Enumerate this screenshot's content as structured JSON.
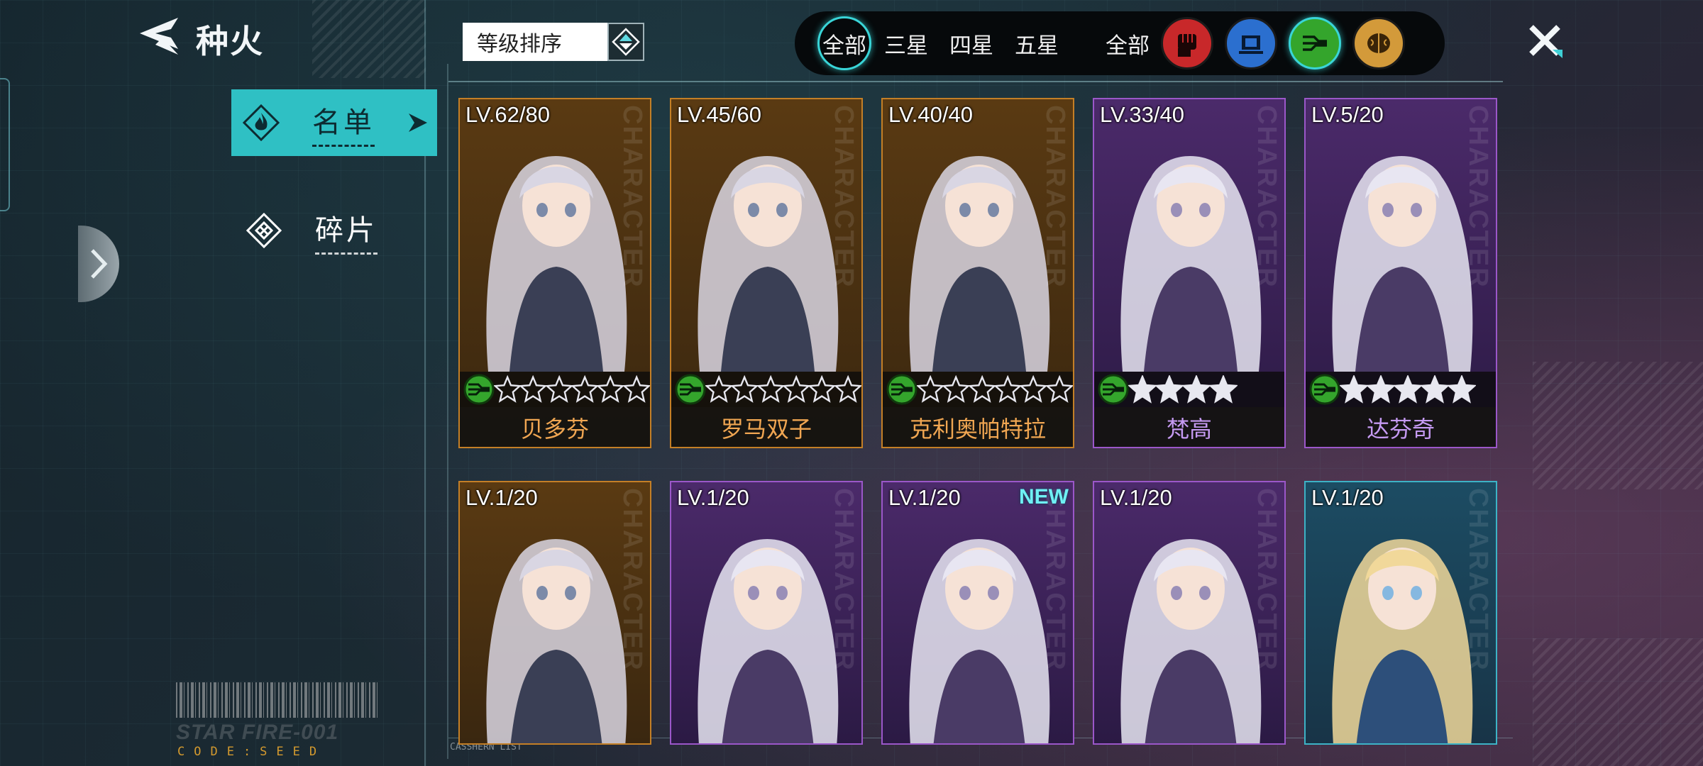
{
  "header": {
    "title": "种火"
  },
  "left_tabs": [
    {
      "label": "名单",
      "active": true
    },
    {
      "label": "碎片",
      "active": false
    }
  ],
  "decor": {
    "star_fire": "STAR FIRE-001",
    "code_seed": "CODE:SEED",
    "list_label": "CASSHERN LIST",
    "watermark": "CHARACTER"
  },
  "sort": {
    "label": "等级排序"
  },
  "filters": {
    "rarity": [
      {
        "label": "全部",
        "active": true
      },
      {
        "label": "三星",
        "active": false
      },
      {
        "label": "四星",
        "active": false
      },
      {
        "label": "五星",
        "active": false
      }
    ],
    "type_all_label": "全部",
    "types": [
      {
        "icon": "fist-icon",
        "color": "#c8282a",
        "active": false
      },
      {
        "icon": "chip-icon",
        "color": "#2b6fcf",
        "active": false
      },
      {
        "icon": "circuit-icon",
        "color": "#34a52c",
        "active": true
      },
      {
        "icon": "brain-icon",
        "color": "#d39a3a",
        "active": false
      }
    ]
  },
  "cards": [
    {
      "level": "LV.62/80",
      "name": "贝多芬",
      "stars": 6,
      "filled_stars": false,
      "frame": "gold",
      "new": false
    },
    {
      "level": "LV.45/60",
      "name": "罗马双子",
      "stars": 6,
      "filled_stars": false,
      "frame": "gold",
      "new": false
    },
    {
      "level": "LV.40/40",
      "name": "克利奥帕特拉",
      "stars": 6,
      "filled_stars": false,
      "frame": "gold",
      "new": false
    },
    {
      "level": "LV.33/40",
      "name": "梵高",
      "stars": 4,
      "filled_stars": true,
      "frame": "purple",
      "new": false
    },
    {
      "level": "LV.5/20",
      "name": "达芬奇",
      "stars": 5,
      "filled_stars": true,
      "frame": "purple",
      "new": false
    },
    {
      "level": "LV.1/20",
      "name": "",
      "frame": "gold",
      "new": false
    },
    {
      "level": "LV.1/20",
      "name": "",
      "frame": "purple",
      "new": false
    },
    {
      "level": "LV.1/20",
      "name": "",
      "frame": "purple",
      "new": true,
      "new_label": "NEW"
    },
    {
      "level": "LV.1/20",
      "name": "",
      "frame": "purple",
      "new": false
    },
    {
      "level": "LV.1/20",
      "name": "",
      "frame": "cyan",
      "new": false
    }
  ]
}
